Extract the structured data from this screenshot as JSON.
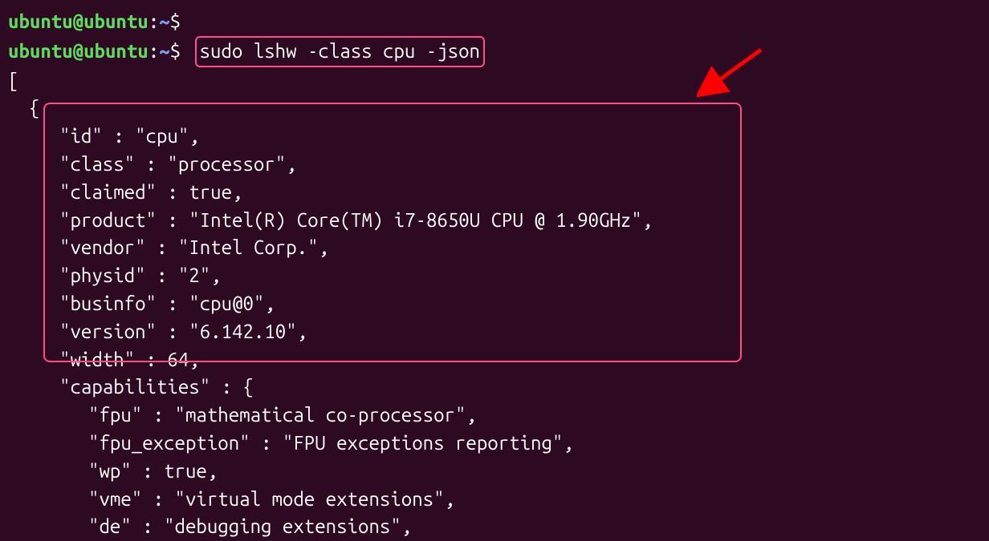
{
  "prompt": {
    "user": "ubuntu@ubuntu",
    "colon": ":",
    "path": "~",
    "dollar": "$"
  },
  "command": "sudo lshw -class cpu -json",
  "json_open_bracket": "[",
  "json_open_brace": "{",
  "json_lines": [
    "\"id\" : \"cpu\",",
    "\"class\" : \"processor\",",
    "\"claimed\" : true,",
    "\"product\" : \"Intel(R) Core(TM) i7-8650U CPU @ 1.90GHz\",",
    "\"vendor\" : \"Intel Corp.\",",
    "\"physid\" : \"2\",",
    "\"businfo\" : \"cpu@0\",",
    "\"version\" : \"6.142.10\",",
    "\"width\" : 64,"
  ],
  "capabilities_line": "\"capabilities\" : {",
  "capabilities": [
    "\"fpu\" : \"mathematical co-processor\",",
    "\"fpu_exception\" : \"FPU exceptions reporting\",",
    "\"wp\" : true,",
    "\"vme\" : \"virtual mode extensions\",",
    "\"de\" : \"debugging extensions\","
  ],
  "highlight_colors": {
    "box": "#ff4d87",
    "arrow": "#ff0000"
  }
}
